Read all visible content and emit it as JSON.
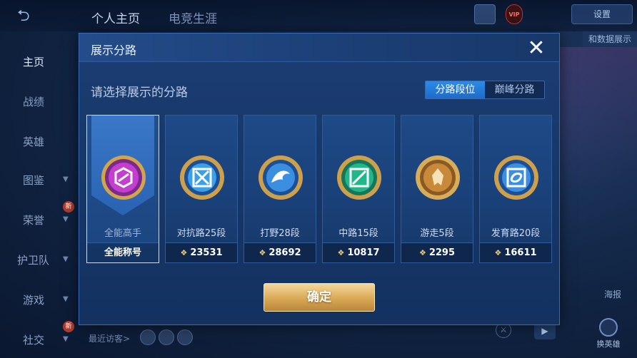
{
  "background": {
    "tabs": [
      "个人主页",
      "电竞生涯"
    ],
    "sidebar": [
      {
        "label": "主页",
        "active": true
      },
      {
        "label": "战绩"
      },
      {
        "label": "英雄"
      },
      {
        "label": "图鉴"
      },
      {
        "label": "荣誉"
      },
      {
        "label": "护卫队"
      },
      {
        "label": "游戏"
      },
      {
        "label": "社交"
      }
    ],
    "badge": "新",
    "settings_label": "设置",
    "data_show_label": "和数据展示",
    "vip_label": "VIP",
    "visitors_label": "最近访客>",
    "right_label": "海报",
    "hero_button_label": "换英雄",
    "play_icon": "play-icon"
  },
  "modal": {
    "title": "展示分路",
    "prompt": "请选择展示的分路",
    "segments": [
      "分路段位",
      "巅峰分路"
    ],
    "selected_segment": 0,
    "cards": [
      {
        "label": "全能高手",
        "footer": "全能称号",
        "selected": true,
        "emblem": "all-round-emblem",
        "accent": "#c13cc9"
      },
      {
        "label": "对抗路25段",
        "points": "23531",
        "emblem": "clash-lane-emblem",
        "accent": "#3aa0e8"
      },
      {
        "label": "打野28段",
        "points": "28692",
        "emblem": "jungle-emblem",
        "accent": "#3a8fe0"
      },
      {
        "label": "中路15段",
        "points": "10817",
        "emblem": "mid-lane-emblem",
        "accent": "#21b889"
      },
      {
        "label": "游走5段",
        "points": "2295",
        "emblem": "roam-emblem",
        "accent": "#c88a3a"
      },
      {
        "label": "发育路20段",
        "points": "16611",
        "emblem": "farm-lane-emblem",
        "accent": "#3a8fe0"
      }
    ],
    "confirm_label": "确定"
  }
}
